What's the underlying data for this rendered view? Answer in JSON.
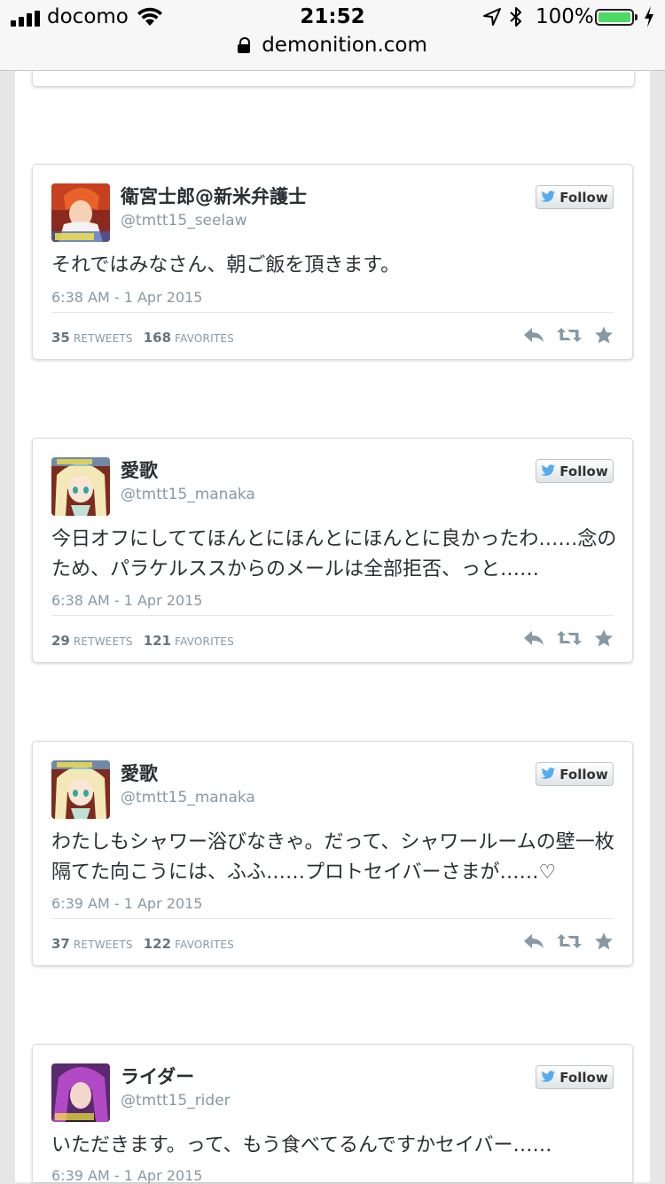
{
  "status_bar": {
    "carrier": "docomo",
    "time": "21:52",
    "battery_percent": "100%",
    "battery_level": 1.0
  },
  "url_bar": {
    "domain": "demonition.com"
  },
  "tweets": [
    {
      "name": "衛宮士郎@新米弁護士",
      "handle": "@tmtt15_seelaw",
      "follow_label": "Follow",
      "text": "それではみなさん、朝ご飯を頂きます。",
      "time": "6:38 AM - 1 Apr 2015",
      "retweets": "35",
      "retweets_label": "RETWEETS",
      "favorites": "168",
      "favorites_label": "FAVORITES",
      "avatar": "orange-haired-boy-avatar"
    },
    {
      "name": "愛歌",
      "handle": "@tmtt15_manaka",
      "follow_label": "Follow",
      "text": "今日オフにしててほんとにほんとにほんとに良かったわ……念のため、パラケルススからのメールは全部拒否、っと……",
      "time": "6:38 AM - 1 Apr 2015",
      "retweets": "29",
      "retweets_label": "RETWEETS",
      "favorites": "121",
      "favorites_label": "FAVORITES",
      "avatar": "blonde-girl-avatar"
    },
    {
      "name": "愛歌",
      "handle": "@tmtt15_manaka",
      "follow_label": "Follow",
      "text": "わたしもシャワー浴びなきゃ。だって、シャワールームの壁一枚隔てた向こうには、ふふ……プロトセイバーさまが……♡",
      "time": "6:39 AM - 1 Apr 2015",
      "retweets": "37",
      "retweets_label": "RETWEETS",
      "favorites": "122",
      "favorites_label": "FAVORITES",
      "avatar": "blonde-girl-avatar"
    },
    {
      "name": "ライダー",
      "handle": "@tmtt15_rider",
      "follow_label": "Follow",
      "text": "いただきます。って、もう食べてるんですかセイバー……",
      "time": "6:39 AM - 1 Apr 2015",
      "avatar": "purple-haired-woman-avatar"
    }
  ]
}
